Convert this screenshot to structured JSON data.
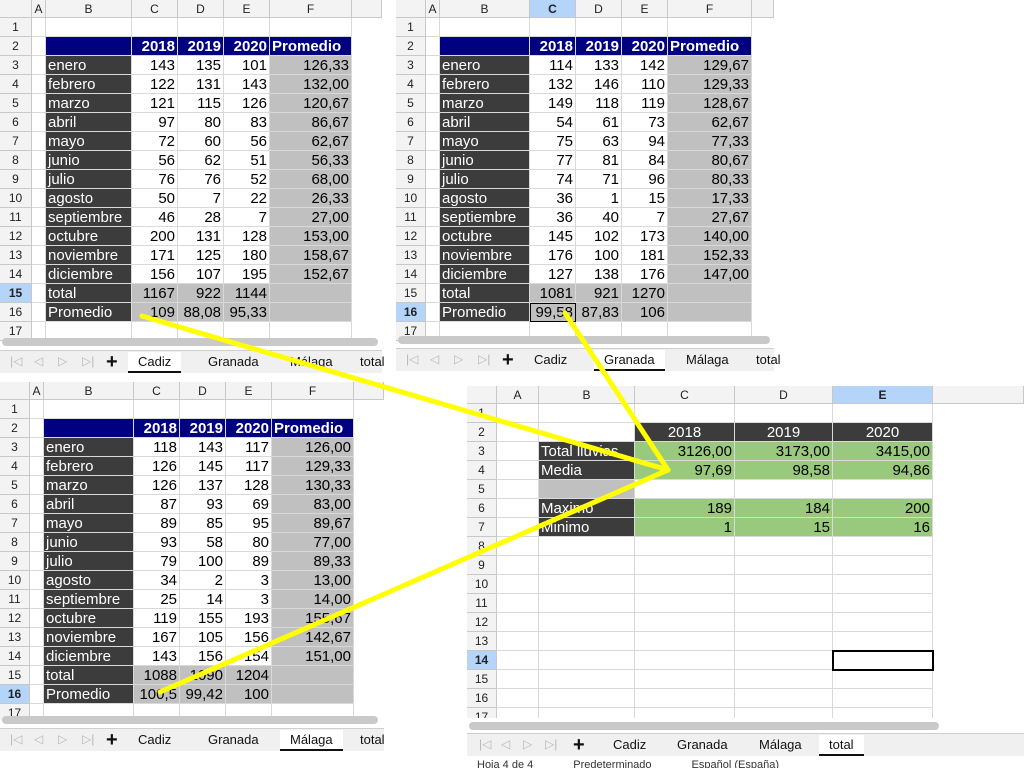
{
  "columns6": [
    "A",
    "B",
    "C",
    "D",
    "E",
    "F"
  ],
  "rows17": [
    "1",
    "2",
    "3",
    "4",
    "5",
    "6",
    "7",
    "8",
    "9",
    "10",
    "11",
    "12",
    "13",
    "14",
    "15",
    "16",
    "17"
  ],
  "sheets": [
    "Cadiz",
    "Granada",
    "Málaga",
    "total"
  ],
  "cadiz": {
    "header": [
      "2018",
      "2019",
      "2020",
      "Promedio"
    ],
    "months": [
      {
        "m": "enero",
        "a": "143",
        "b": "135",
        "c": "101",
        "p": "126,33"
      },
      {
        "m": "febrero",
        "a": "122",
        "b": "131",
        "c": "143",
        "p": "132,00"
      },
      {
        "m": "marzo",
        "a": "121",
        "b": "115",
        "c": "126",
        "p": "120,67"
      },
      {
        "m": "abril",
        "a": "97",
        "b": "80",
        "c": "83",
        "p": "86,67"
      },
      {
        "m": "mayo",
        "a": "72",
        "b": "60",
        "c": "56",
        "p": "62,67"
      },
      {
        "m": "junio",
        "a": "56",
        "b": "62",
        "c": "51",
        "p": "56,33"
      },
      {
        "m": "julio",
        "a": "76",
        "b": "76",
        "c": "52",
        "p": "68,00"
      },
      {
        "m": "agosto",
        "a": "50",
        "b": "7",
        "c": "22",
        "p": "26,33"
      },
      {
        "m": "septiembre",
        "a": "46",
        "b": "28",
        "c": "7",
        "p": "27,00"
      },
      {
        "m": "octubre",
        "a": "200",
        "b": "131",
        "c": "128",
        "p": "153,00"
      },
      {
        "m": "noviembre",
        "a": "171",
        "b": "125",
        "c": "180",
        "p": "158,67"
      },
      {
        "m": "diciembre",
        "a": "156",
        "b": "107",
        "c": "195",
        "p": "152,67"
      }
    ],
    "total": {
      "label": "total",
      "a": "1167",
      "b": "922",
      "c": "1144"
    },
    "promedio": {
      "label": "Promedio",
      "a": "109",
      "b": "88,08",
      "c": "95,33"
    }
  },
  "granada": {
    "header": [
      "2018",
      "2019",
      "2020",
      "Promedio"
    ],
    "months": [
      {
        "m": "enero",
        "a": "114",
        "b": "133",
        "c": "142",
        "p": "129,67"
      },
      {
        "m": "febrero",
        "a": "132",
        "b": "146",
        "c": "110",
        "p": "129,33"
      },
      {
        "m": "marzo",
        "a": "149",
        "b": "118",
        "c": "119",
        "p": "128,67"
      },
      {
        "m": "abril",
        "a": "54",
        "b": "61",
        "c": "73",
        "p": "62,67"
      },
      {
        "m": "mayo",
        "a": "75",
        "b": "63",
        "c": "94",
        "p": "77,33"
      },
      {
        "m": "junio",
        "a": "77",
        "b": "81",
        "c": "84",
        "p": "80,67"
      },
      {
        "m": "julio",
        "a": "74",
        "b": "71",
        "c": "96",
        "p": "80,33"
      },
      {
        "m": "agosto",
        "a": "36",
        "b": "1",
        "c": "15",
        "p": "17,33"
      },
      {
        "m": "septiembre",
        "a": "36",
        "b": "40",
        "c": "7",
        "p": "27,67"
      },
      {
        "m": "octubre",
        "a": "145",
        "b": "102",
        "c": "173",
        "p": "140,00"
      },
      {
        "m": "noviembre",
        "a": "176",
        "b": "100",
        "c": "181",
        "p": "152,33"
      },
      {
        "m": "diciembre",
        "a": "127",
        "b": "138",
        "c": "176",
        "p": "147,00"
      }
    ],
    "total": {
      "label": "total",
      "a": "1081",
      "b": "921",
      "c": "1270"
    },
    "promedio": {
      "label": "Promedio",
      "a": "99,58",
      "b": "87,83",
      "c": "106"
    }
  },
  "malaga": {
    "header": [
      "2018",
      "2019",
      "2020",
      "Promedio"
    ],
    "months": [
      {
        "m": "enero",
        "a": "118",
        "b": "143",
        "c": "117",
        "p": "126,00"
      },
      {
        "m": "febrero",
        "a": "126",
        "b": "145",
        "c": "117",
        "p": "129,33"
      },
      {
        "m": "marzo",
        "a": "126",
        "b": "137",
        "c": "128",
        "p": "130,33"
      },
      {
        "m": "abril",
        "a": "87",
        "b": "93",
        "c": "69",
        "p": "83,00"
      },
      {
        "m": "mayo",
        "a": "89",
        "b": "85",
        "c": "95",
        "p": "89,67"
      },
      {
        "m": "junio",
        "a": "93",
        "b": "58",
        "c": "80",
        "p": "77,00"
      },
      {
        "m": "julio",
        "a": "79",
        "b": "100",
        "c": "89",
        "p": "89,33"
      },
      {
        "m": "agosto",
        "a": "34",
        "b": "2",
        "c": "3",
        "p": "13,00"
      },
      {
        "m": "septiembre",
        "a": "25",
        "b": "14",
        "c": "3",
        "p": "14,00"
      },
      {
        "m": "octubre",
        "a": "119",
        "b": "155",
        "c": "193",
        "p": "155,67"
      },
      {
        "m": "noviembre",
        "a": "167",
        "b": "105",
        "c": "156",
        "p": "142,67"
      },
      {
        "m": "diciembre",
        "a": "143",
        "b": "156",
        "c": "154",
        "p": "151,00"
      }
    ],
    "total": {
      "label": "total",
      "a": "1088",
      "b": "1090",
      "c": "1204"
    },
    "promedio": {
      "label": "Promedio",
      "a": "100,5",
      "b": "99,42",
      "c": "100"
    }
  },
  "total_sheet": {
    "columns": [
      "A",
      "B",
      "C",
      "D",
      "E"
    ],
    "header": [
      "2018",
      "2019",
      "2020"
    ],
    "rows": [
      {
        "label": "Total lluvias",
        "a": "3126,00",
        "b": "3173,00",
        "c": "3415,00"
      },
      {
        "label": "Media",
        "a": "97,69",
        "b": "98,58",
        "c": "94,86"
      },
      {
        "label": "Maximo",
        "a": "189",
        "b": "184",
        "c": "200"
      },
      {
        "label": "Minimo",
        "a": "1",
        "b": "15",
        "c": "16"
      }
    ],
    "status": [
      "Hoja 4 de 4",
      "Predeterminado",
      "Español (España)"
    ]
  },
  "colors": {
    "header_blue": "#000080",
    "dark": "#3c3c3c",
    "grey": "#c0c0c0",
    "green": "#99c97d",
    "arrow": "#ffff00"
  }
}
